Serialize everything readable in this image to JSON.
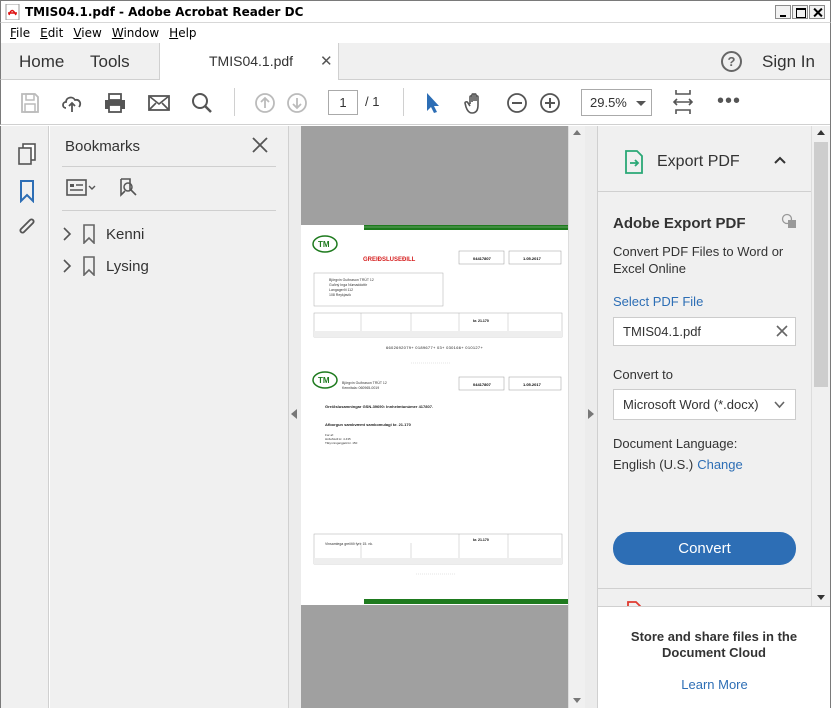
{
  "window": {
    "title": "TMIS04.1.pdf - Adobe Acrobat Reader DC"
  },
  "menu": [
    {
      "label": "File",
      "key": "F",
      "rest": "ile"
    },
    {
      "label": "Edit",
      "key": "E",
      "rest": "dit"
    },
    {
      "label": "View",
      "key": "V",
      "rest": "iew"
    },
    {
      "label": "Window",
      "key": "W",
      "rest": "indow"
    },
    {
      "label": "Help",
      "key": "H",
      "rest": "elp"
    }
  ],
  "tabs": {
    "home": "Home",
    "tools": "Tools",
    "document": "TMIS04.1.pdf",
    "close_glyph": "✕",
    "help_glyph": "?",
    "sign_in": "Sign In"
  },
  "toolbar": {
    "page_current": "1",
    "page_total": "/ 1",
    "zoom": "29.5%",
    "more": "•••",
    "icons": [
      "save-icon",
      "upload-icon",
      "print-icon",
      "email-icon",
      "search-icon",
      "page-up-icon",
      "page-down-icon",
      "select-cursor-icon",
      "hand-icon",
      "zoom-out-icon",
      "zoom-in-icon",
      "fit-page-icon",
      "more-icon"
    ]
  },
  "rail": {
    "icons": [
      "pages-icon",
      "bookmark-icon",
      "attachment-icon"
    ]
  },
  "bookmarks": {
    "title": "Bookmarks",
    "items": [
      {
        "label": "Kenni"
      },
      {
        "label": "Lysing"
      }
    ]
  },
  "document": {
    "header_title": "GREIÐSLUSEÐILL",
    "invoice_no": "04417807",
    "date": "1.05.2017",
    "recipient_lines": [
      "Björgvin Guðnason TRÚT 12",
      "Guðný Inga Númaddottir",
      "Langagerði 112",
      "108 Reykjavík"
    ],
    "amount_line": "kr. 21.170",
    "barcode_line": "6602692079+ 0189677+ 03+ 030166+ 010127+",
    "second_recipient": [
      "Björgvin Guðnason TRÚT 12",
      "Kennitala: 060965-0019"
    ],
    "second_invoice_no": "04417807",
    "second_date": "1.05.2017",
    "heading_1": "Greiðslusamningar GSN-39690: Innheimtunúmer 417807.",
    "heading_2": "Afborgun samkvæmt samkomulagi kr. 21.170",
    "notes": [
      "Þar af:",
      "Höfuðstóll kr. 4.435",
      "Tilkynningargjald kr. 150"
    ],
    "bottom_note": "Vinsamlega greiðið fyrir 15. nk.",
    "bottom_amount": "kr. 21.170",
    "accent_color": "#1e7a1e",
    "title_color": "#d62020"
  },
  "export_pane": {
    "header": "Export PDF",
    "subtitle": "Adobe Export PDF",
    "description": "Convert PDF Files to Word or Excel Online",
    "select_pdf": "Select PDF File",
    "file_name": "TMIS04.1.pdf",
    "convert_to_label": "Convert to",
    "format": "Microsoft Word (*.docx)",
    "language_label": "Document Language:",
    "language": "English (U.S.)",
    "change": "Change",
    "convert_button": "Convert",
    "store_text": "Store and share files in the Document Cloud",
    "learn_more": "Learn More",
    "accent_color": "#2d6eb5"
  }
}
